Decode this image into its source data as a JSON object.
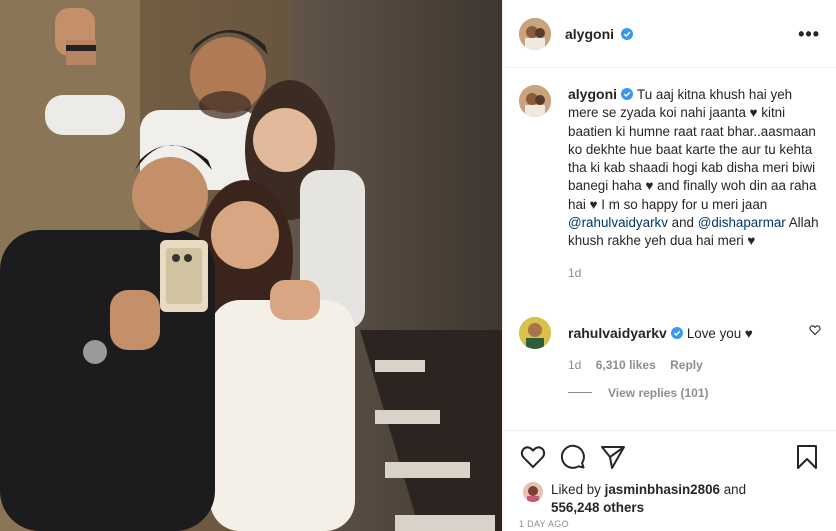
{
  "post": {
    "author": "alygoni",
    "author_verified": true,
    "more_label": "•••",
    "photo_description_icon": "photo-icon",
    "caption": {
      "username": "alygoni",
      "seg1": "Tu aaj kitna khush hai yeh mere se zyada koi nahi jaanta ♥ kitni baatien ki humne raat raat bhar..aasmaan ko dekhte hue baat karte the aur tu kehta tha ki kab shaadi hogi kab disha meri biwi banegi haha ♥ and finally woh din aa raha hai ♥ I m so happy for u meri jaan ",
      "mention1": "@rahulvaidyarkv",
      "seg2": " and ",
      "mention2": "@dishaparmar",
      "seg3": " Allah khush rakhe yeh dua hai meri ♥",
      "age": "1d"
    },
    "comment": {
      "username": "rahulvaidyarkv",
      "verified": true,
      "text": "Love you ♥",
      "age": "1d",
      "likes": "6,310 likes",
      "reply_label": "Reply",
      "view_replies": "View replies (101)"
    },
    "likes": {
      "prefix": "Liked by ",
      "user": "jasminbhasin2806",
      "mid": " and",
      "count": "556,248 others"
    },
    "timestamp": "1 DAY AGO"
  },
  "colors": {
    "text": "#262626",
    "secondary": "#8e8e8e",
    "link": "#00376b",
    "verified": "#3897f0",
    "border": "#efefef"
  },
  "icons": [
    "heart-icon",
    "comment-icon",
    "share-icon",
    "bookmark-icon",
    "verified-badge-icon",
    "more-options-icon"
  ]
}
